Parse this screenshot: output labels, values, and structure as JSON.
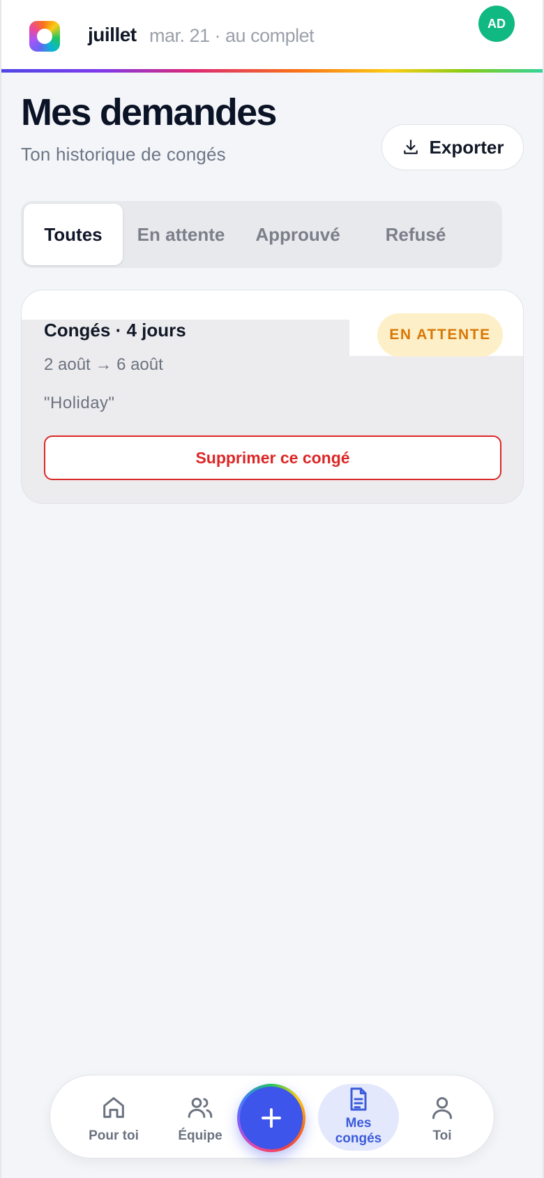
{
  "header": {
    "month": "juillet",
    "date_status": "mar. 21 · au complet",
    "avatar_initials": "AD"
  },
  "page": {
    "title": "Mes demandes",
    "subtitle": "Ton historique de congés",
    "export_label": "Exporter"
  },
  "tabs": [
    {
      "label": "Toutes",
      "active": true
    },
    {
      "label": "En attente",
      "active": false
    },
    {
      "label": "Approuvé",
      "active": false
    },
    {
      "label": "Refusé",
      "active": false
    }
  ],
  "requests": [
    {
      "title": "Congés · 4 jours",
      "status": "EN ATTENTE",
      "dates": "2 août → 6 août",
      "reason": "\"Holiday\"",
      "delete_label": "Supprimer ce congé"
    }
  ],
  "bottom_nav": {
    "items": [
      {
        "label": "Pour toi",
        "icon": "home-icon"
      },
      {
        "label": "Équipe",
        "icon": "users-icon"
      },
      {
        "label": "Mes congés",
        "icon": "document-icon",
        "active": true
      },
      {
        "label": "Toi",
        "icon": "user-icon"
      }
    ],
    "fab_icon": "plus-icon"
  },
  "colors": {
    "accent": "#3d55eb",
    "avatar": "#10b981",
    "pending_bg": "#fdf0c8",
    "pending_text": "#d97706",
    "danger": "#dc2626"
  }
}
